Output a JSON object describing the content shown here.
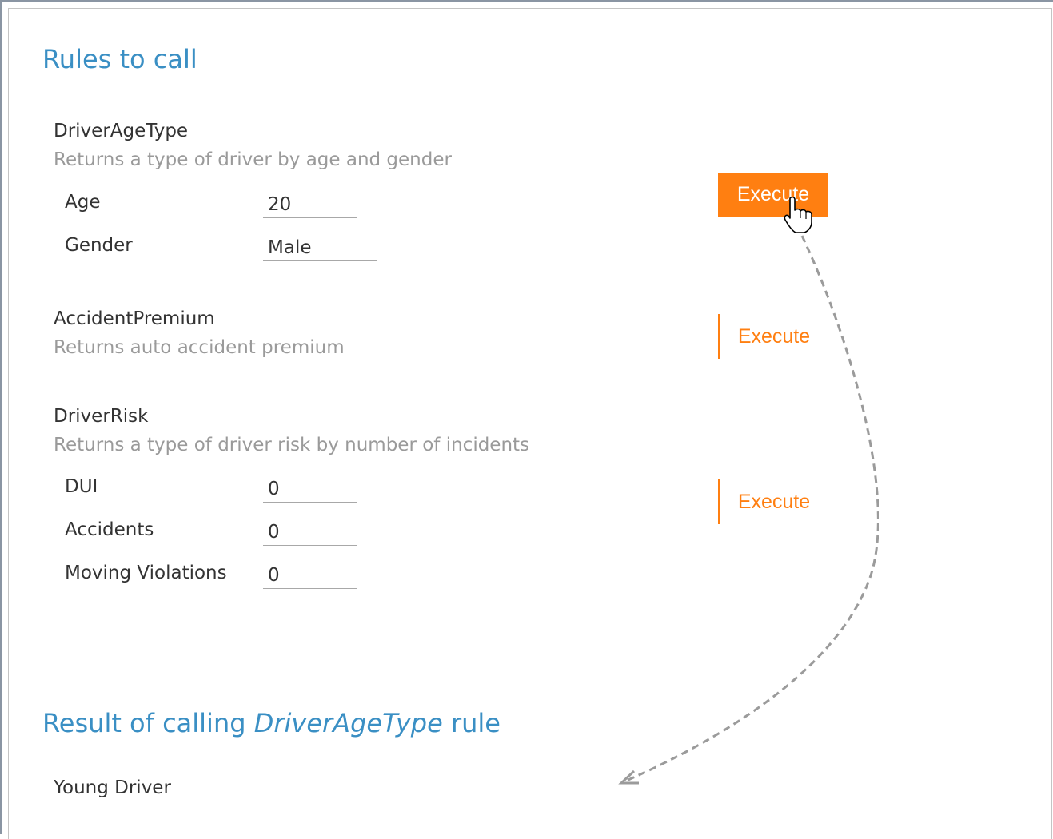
{
  "rules_section": {
    "title": "Rules to call"
  },
  "rules": [
    {
      "name": "DriverAgeType",
      "description": "Returns a type of driver by age and gender",
      "params": [
        {
          "label": "Age",
          "value": "20"
        },
        {
          "label": "Gender",
          "value": "Male"
        }
      ],
      "execute_label": "Execute"
    },
    {
      "name": "AccidentPremium",
      "description": "Returns auto accident premium",
      "params": [],
      "execute_label": "Execute"
    },
    {
      "name": "DriverRisk",
      "description": "Returns a type of driver risk by number of incidents",
      "params": [
        {
          "label": "DUI",
          "value": "0"
        },
        {
          "label": "Accidents",
          "value": "0"
        },
        {
          "label": "Moving Violations",
          "value": "0"
        }
      ],
      "execute_label": "Execute"
    }
  ],
  "result_section": {
    "title_prefix": "Result of calling ",
    "title_rule": "DriverAgeType",
    "title_suffix": " rule",
    "value": "Young Driver"
  },
  "colors": {
    "title_blue": "#3a8fc4",
    "accent_orange": "#ff7f11",
    "description_gray": "#9a9a9a"
  },
  "icons": {
    "cursor": "hand-pointer-cursor-icon",
    "arrow": "dashed-curved-arrow-icon"
  }
}
